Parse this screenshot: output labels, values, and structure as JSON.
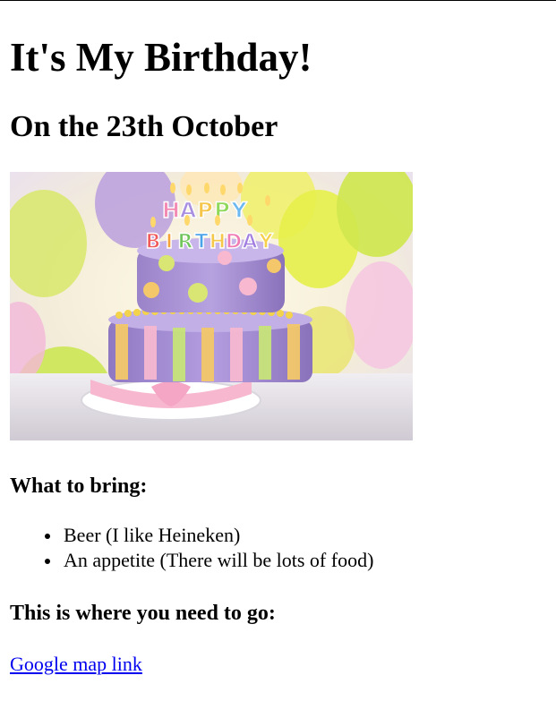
{
  "page": {
    "title": "It's My Birthday!",
    "date_line": "On the 23th October"
  },
  "image": {
    "description_icon": "birthday-cake-photo",
    "cake_lettering": {
      "top_word": "HAPPY",
      "bottom_word": "BIRTHDAY"
    }
  },
  "bring": {
    "heading": "What to bring:",
    "items": [
      "Beer (I like Heineken)",
      "An appetite (There will be lots of food)"
    ]
  },
  "directions": {
    "heading": "This is where you need to go:",
    "link_text": "Google map link"
  },
  "colors": {
    "link": "#0000ee",
    "text": "#000000",
    "background": "#ffffff"
  }
}
